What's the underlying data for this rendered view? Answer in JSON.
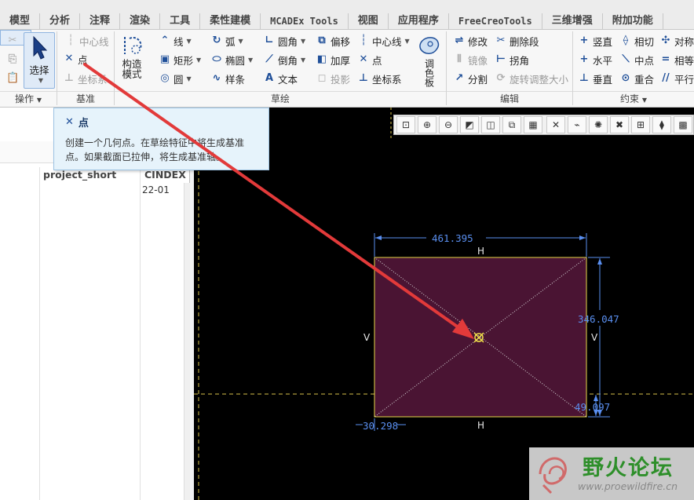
{
  "menu_tabs": [
    "模型",
    "分析",
    "注释",
    "渲染",
    "工具",
    "柔性建模",
    "MCADEx Tools",
    "视图",
    "应用程序",
    "FreeCreoTools",
    "三维增强",
    "附加功能"
  ],
  "ribbon": {
    "operations": {
      "select_label": "选择",
      "footer": "操作"
    },
    "datum": {
      "centerline": "中心线",
      "point": "点",
      "coord_sys": "坐标系",
      "footer": "基准"
    },
    "construct_mode": {
      "line1": "构造",
      "line2": "模式"
    },
    "sketch": {
      "line": "线",
      "arc": "弧",
      "fillet": "圆角",
      "offset": "偏移",
      "centerline": "中心线",
      "rectangle": "矩形",
      "ellipse": "椭圆",
      "chamfer": "倒角",
      "thicken": "加厚",
      "point": "点",
      "circle": "圆",
      "spline": "样条",
      "text": "文本",
      "project": "投影",
      "coord_sys": "坐标系",
      "palette": "调色板",
      "footer": "草绘"
    },
    "edit": {
      "modify": "修改",
      "delete_segment": "删除段",
      "mirror": "镜像",
      "corner": "拐角",
      "divide": "分割",
      "rotate_resize": "旋转调整大小",
      "footer": "编辑"
    },
    "constrain": {
      "vertical": "竖直",
      "tangent": "相切",
      "symmetric": "对称",
      "horizontal": "水平",
      "midpoint": "中点",
      "equal": "相等",
      "perpendicular": "垂直",
      "coincident": "重合",
      "parallel": "平行",
      "footer": "约束"
    }
  },
  "tooltip": {
    "title": "点",
    "desc1": "创建一个几何点。在草绘特征中将生成基准",
    "desc2": "点。如果截面已拉伸，将生成基准轴。"
  },
  "left_panel": {
    "col1": "project_short",
    "col2": "CINDEX",
    "value": "22-01"
  },
  "sketch": {
    "dim_top": "461.395",
    "dim_right": "346.047",
    "dim_bottom_right": "49.097",
    "dim_bottom_left": "30.298",
    "constraint_h": "H",
    "constraint_v": "V"
  },
  "colors": {
    "rect_fill": "#4a1433",
    "rect_border": "#e8d84a",
    "dimension": "#5a8ff0",
    "arrow": "#e23a3a",
    "centerline": "#d8c24a"
  },
  "watermark": {
    "title": "野火论坛",
    "url": "www.proewildfire.cn"
  }
}
